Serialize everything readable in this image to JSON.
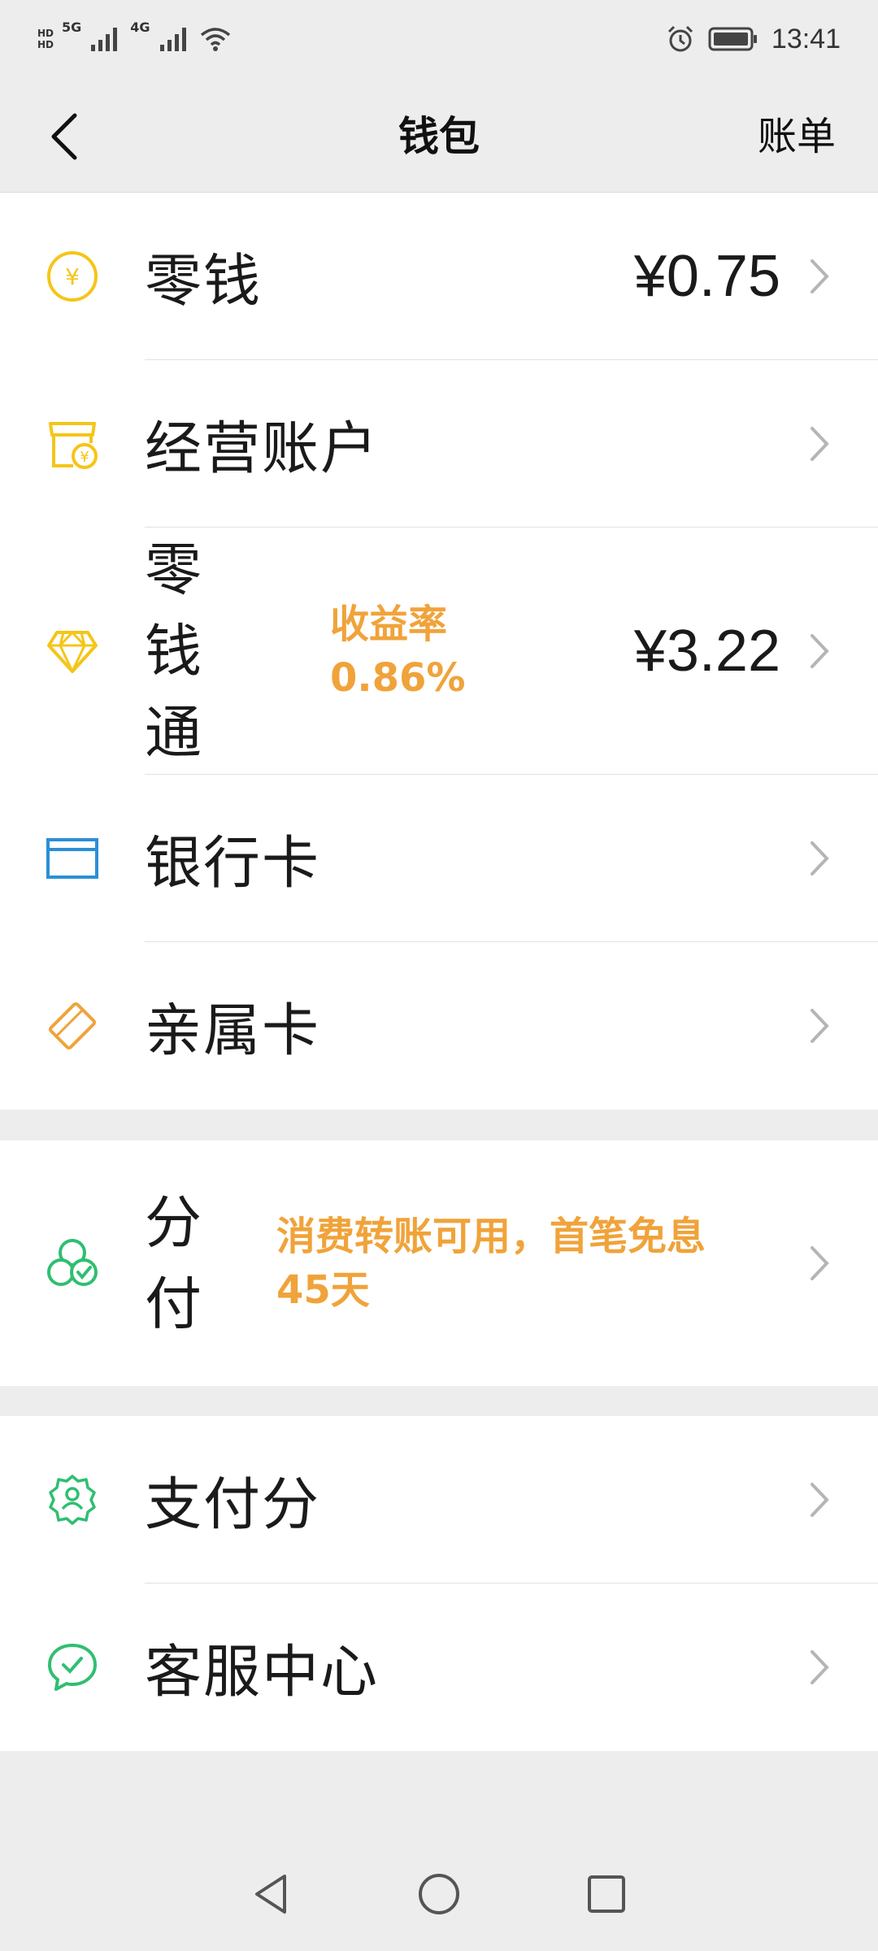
{
  "status_bar": {
    "time": "13:41",
    "hd1": "HD",
    "hd2": "HD",
    "net1": "5G",
    "net2": "4G"
  },
  "header": {
    "title": "钱包",
    "bill": "账单"
  },
  "groups": {
    "g1": [
      {
        "label": "零钱",
        "value": "¥0.75",
        "icon": "yuan-coin-icon"
      },
      {
        "label": "经营账户",
        "icon": "store-yuan-icon"
      },
      {
        "label": "零钱通",
        "sub_line1": "收益率",
        "sub_line2": "0.86%",
        "value": "¥3.22",
        "icon": "diamond-icon"
      },
      {
        "label": "银行卡",
        "icon": "bank-card-icon"
      },
      {
        "label": "亲属卡",
        "icon": "family-card-icon"
      }
    ],
    "g2": [
      {
        "label": "分付",
        "sub_line1": "消费转账可用，首笔免息",
        "sub_line2": "45天",
        "icon": "fenfu-circles-icon"
      }
    ],
    "g3": [
      {
        "label": "支付分",
        "icon": "credit-badge-icon"
      },
      {
        "label": "客服中心",
        "icon": "service-chat-icon"
      }
    ]
  },
  "colors": {
    "accent_yellow": "#f5c518",
    "accent_orange": "#f0a33a",
    "accent_green": "#2fbf71",
    "accent_blue": "#2b8fd6"
  }
}
